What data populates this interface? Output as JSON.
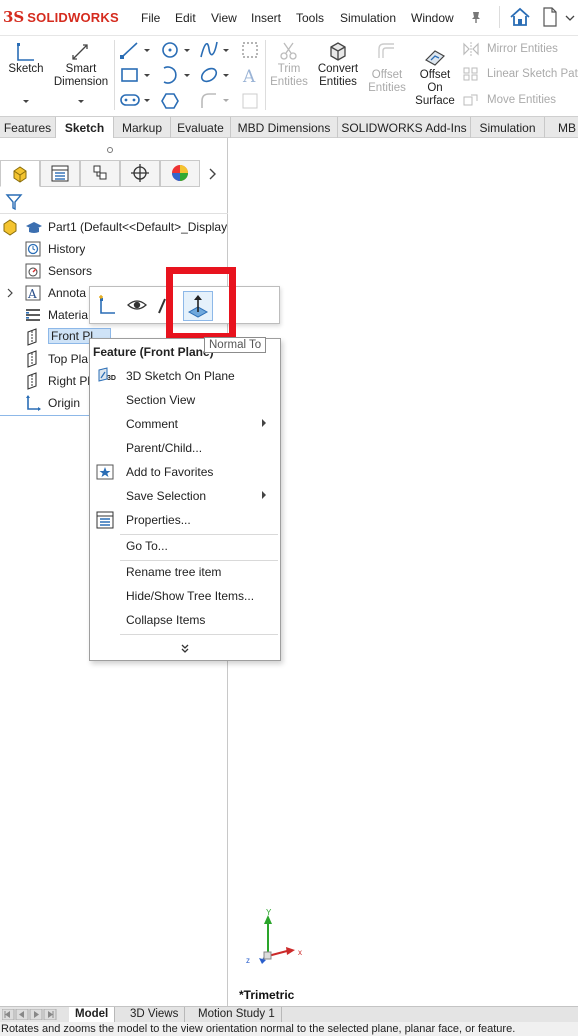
{
  "app": {
    "brand_ds": "3S",
    "brand_name": "SOLIDWORKS"
  },
  "menubar": {
    "items": [
      "File",
      "Edit",
      "View",
      "Insert",
      "Tools",
      "Simulation",
      "Window"
    ]
  },
  "ribbon": {
    "sketch": "Sketch",
    "smart_dimension_1": "Smart",
    "smart_dimension_2": "Dimension",
    "trim_1": "Trim",
    "trim_2": "Entities",
    "convert_1": "Convert",
    "convert_2": "Entities",
    "offset_1": "Offset",
    "offset_2": "Entities",
    "offset_surface_1": "Offset",
    "offset_surface_2": "On",
    "offset_surface_3": "Surface",
    "mirror": "Mirror Entities",
    "linear_pattern": "Linear Sketch Patt",
    "move": "Move Entities"
  },
  "tabs": [
    "Features",
    "Sketch",
    "Markup",
    "Evaluate",
    "MBD Dimensions",
    "SOLIDWORKS Add-Ins",
    "Simulation",
    "MB"
  ],
  "active_tab": "Sketch",
  "tree": {
    "root": "Part1  (Default<<Default>_Display",
    "items": [
      "History",
      "Sensors",
      "Annota",
      "Materia",
      "Front Pl",
      "Top Pla",
      "Right Pl",
      "Origin"
    ]
  },
  "context": {
    "tooltip": "Normal To",
    "title": "Feature (Front Plane)",
    "items": {
      "sketch3d": "3D Sketch On Plane",
      "section": "Section View",
      "comment": "Comment",
      "parent_child": "Parent/Child...",
      "favorites": "Add to Favorites",
      "save_selection": "Save Selection",
      "properties": "Properties...",
      "goto": "Go To...",
      "rename": "Rename tree item",
      "hide_show": "Hide/Show Tree Items...",
      "collapse": "Collapse Items"
    },
    "icon_3d_label": "3D"
  },
  "triad": {
    "x": "x",
    "y": "Y",
    "z": "z"
  },
  "view_label": "*Trimetric",
  "bottom_tabs": [
    "Model",
    "3D Views",
    "Motion Study 1"
  ],
  "status": "Rotates and zooms the model to the view orientation normal to the selected plane, planar face, or feature.",
  "colors": {
    "brand_red": "#d52b1e",
    "highlight_red": "#e8131e",
    "selection_blue": "#cfe3f7",
    "icon_blue": "#2a6db5"
  }
}
